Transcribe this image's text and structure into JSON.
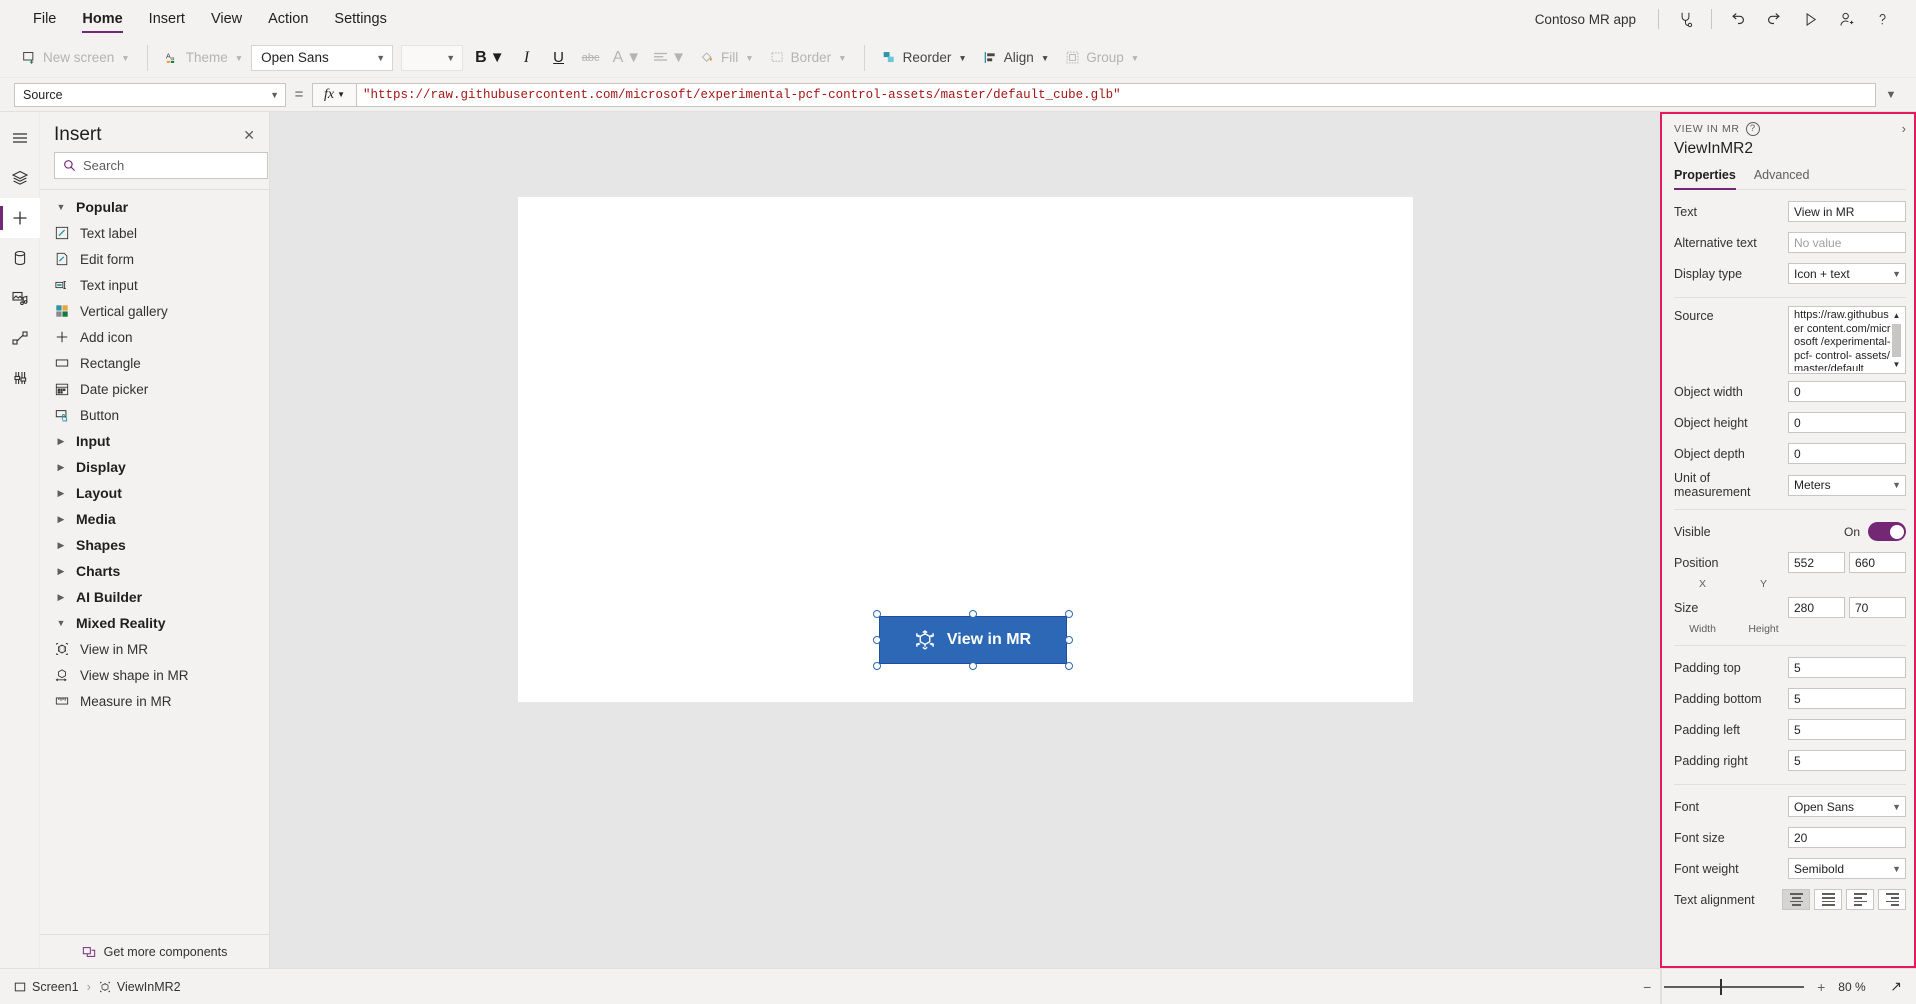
{
  "menubar": {
    "items": [
      {
        "label": "File",
        "active": false
      },
      {
        "label": "Home",
        "active": true
      },
      {
        "label": "Insert",
        "active": false
      },
      {
        "label": "View",
        "active": false
      },
      {
        "label": "Action",
        "active": false
      },
      {
        "label": "Settings",
        "active": false
      }
    ],
    "app_name": "Contoso MR app",
    "icons": [
      "app-checker-icon",
      "undo-icon",
      "redo-icon",
      "preview-play-icon",
      "share-icon",
      "help-icon"
    ]
  },
  "ribbon": {
    "new_screen": "New screen",
    "theme": "Theme",
    "font_family": "Open Sans",
    "font_size": "",
    "bold": "B",
    "italic": "I",
    "underline": "U",
    "strikethrough": "abc",
    "font_color": "A",
    "align": "align",
    "fill": "Fill",
    "border": "Border",
    "reorder": "Reorder",
    "align_group": "Align",
    "group": "Group"
  },
  "formula": {
    "property": "Source",
    "equals": "=",
    "fx": "fx",
    "value": "\"https://raw.githubusercontent.com/microsoft/experimental-pcf-control-assets/master/default_cube.glb\"",
    "url_part": "https://raw.githubusercontent.com/microsoft/experimental-pcf-control-assets/master/default_cube.glb"
  },
  "rail": {
    "items": [
      {
        "name": "hamburger-menu-icon",
        "active": false
      },
      {
        "name": "tree-view-icon",
        "active": false
      },
      {
        "name": "insert-icon",
        "active": true
      },
      {
        "name": "data-icon",
        "active": false
      },
      {
        "name": "media-icon",
        "active": false
      },
      {
        "name": "power-automate-icon",
        "active": false
      },
      {
        "name": "variables-icon",
        "active": false
      }
    ]
  },
  "insert_panel": {
    "title": "Insert",
    "close_label": "✕",
    "search_placeholder": "Search",
    "search_value": "",
    "more_label": "⋮",
    "groups": [
      {
        "label": "Popular",
        "expanded": true,
        "items": [
          {
            "label": "Text label",
            "icon": "text-label-icon"
          },
          {
            "label": "Edit form",
            "icon": "edit-form-icon"
          },
          {
            "label": "Text input",
            "icon": "text-input-icon"
          },
          {
            "label": "Vertical gallery",
            "icon": "vertical-gallery-icon"
          },
          {
            "label": "Add icon",
            "icon": "add-icon"
          },
          {
            "label": "Rectangle",
            "icon": "rectangle-icon"
          },
          {
            "label": "Date picker",
            "icon": "date-picker-icon"
          },
          {
            "label": "Button",
            "icon": "button-icon"
          }
        ]
      },
      {
        "label": "Input",
        "expanded": false,
        "items": []
      },
      {
        "label": "Display",
        "expanded": false,
        "items": []
      },
      {
        "label": "Layout",
        "expanded": false,
        "items": []
      },
      {
        "label": "Media",
        "expanded": false,
        "items": []
      },
      {
        "label": "Shapes",
        "expanded": false,
        "items": []
      },
      {
        "label": "Charts",
        "expanded": false,
        "items": []
      },
      {
        "label": "AI Builder",
        "expanded": false,
        "items": []
      },
      {
        "label": "Mixed Reality",
        "expanded": true,
        "items": [
          {
            "label": "View in MR",
            "icon": "view-in-mr-icon"
          },
          {
            "label": "View shape in MR",
            "icon": "view-shape-in-mr-icon"
          },
          {
            "label": "Measure in MR",
            "icon": "measure-in-mr-icon"
          }
        ]
      }
    ],
    "footer": "Get more components"
  },
  "canvas": {
    "mr_button_label": "View in MR",
    "mr_button_icon": "cube-3d-icon",
    "mr_button_color": "#2c68b5"
  },
  "properties": {
    "kicker": "VIEW IN MR",
    "help_glyph": "?",
    "collapse_glyph": "›",
    "control_name": "ViewInMR2",
    "tabs": [
      {
        "label": "Properties",
        "active": true
      },
      {
        "label": "Advanced",
        "active": false
      }
    ],
    "fields": {
      "text_label": "Text",
      "text_value": "View in MR",
      "alt_text_label": "Alternative text",
      "alt_text_placeholder": "No value",
      "display_type_label": "Display type",
      "display_type_value": "Icon + text",
      "source_label": "Source",
      "source_value": "https://raw.githubusercontent.com/microsoft/experimental-pcf-control-assets/master/default_cube.glb",
      "source_visible_text": "https://raw.githubuser content.com/microsoft /experimental-pcf- control- assets/master/default_",
      "object_width_label": "Object width",
      "object_width_value": "0",
      "object_height_label": "Object height",
      "object_height_value": "0",
      "object_depth_label": "Object depth",
      "object_depth_value": "0",
      "unit_label": "Unit of measurement",
      "unit_value": "Meters",
      "visible_label": "Visible",
      "visible_state": "On",
      "position_label": "Position",
      "position_x": "552",
      "position_y": "660",
      "position_x_sub": "X",
      "position_y_sub": "Y",
      "size_label": "Size",
      "size_width": "280",
      "size_height": "70",
      "size_width_sub": "Width",
      "size_height_sub": "Height",
      "padding_top_label": "Padding top",
      "padding_top_value": "5",
      "padding_bottom_label": "Padding bottom",
      "padding_bottom_value": "5",
      "padding_left_label": "Padding left",
      "padding_left_value": "5",
      "padding_right_label": "Padding right",
      "padding_right_value": "5",
      "font_label": "Font",
      "font_value": "Open Sans",
      "font_size_label": "Font size",
      "font_size_value": "20",
      "font_weight_label": "Font weight",
      "font_weight_value": "Semibold",
      "text_alignment_label": "Text alignment"
    },
    "accent_color": "#742774",
    "highlight_color": "#e5195e"
  },
  "statusbar": {
    "screen": "Screen1",
    "control": "ViewInMR2",
    "separator": "›",
    "zoom_minus": "−",
    "zoom_plus": "+",
    "zoom_value": "80",
    "zoom_unit": "%",
    "expand_glyph": "↗"
  }
}
